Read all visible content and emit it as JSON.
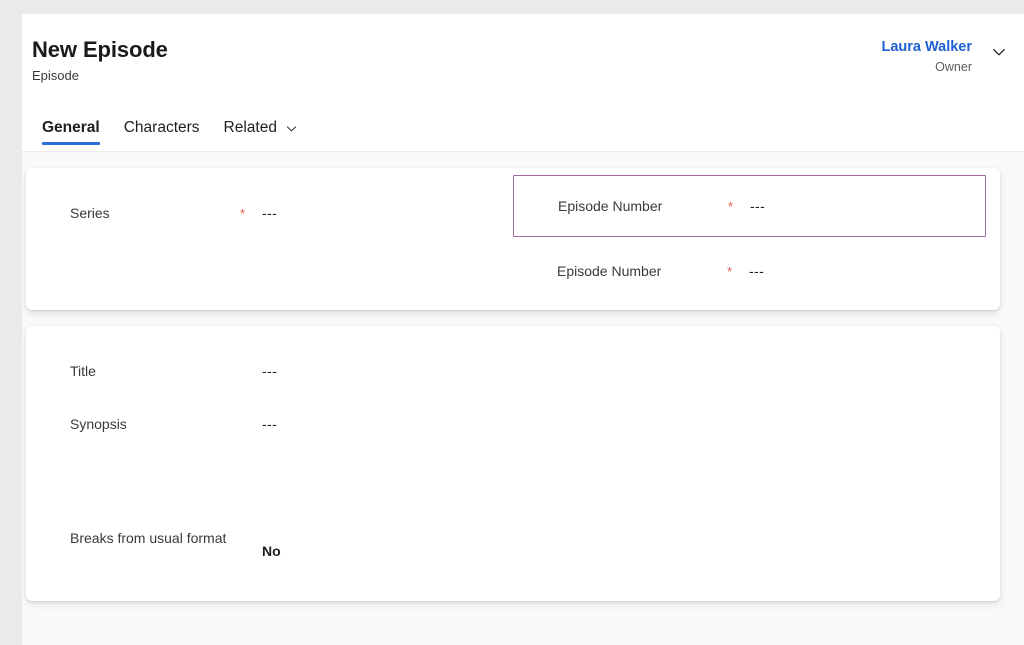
{
  "header": {
    "title": "New Episode",
    "subtitle": "Episode",
    "owner": {
      "name": "Laura Walker",
      "role": "Owner",
      "chevron_icon": "chevron-down-icon"
    }
  },
  "tabs": [
    {
      "label": "General",
      "active": true,
      "has_caret": false
    },
    {
      "label": "Characters",
      "active": false,
      "has_caret": false
    },
    {
      "label": "Related",
      "active": false,
      "has_caret": true,
      "caret_icon": "chevron-down-icon"
    }
  ],
  "colors": {
    "accent_blue": "#2b6bd8",
    "link_blue": "#1f60d1",
    "required_red": "#e8584d",
    "selection_purple": "#a1699c",
    "page_bg": "#faf9f8",
    "card_bg": "#ffffff",
    "frame_bg": "#ebeaea"
  },
  "required_marker": "*",
  "cards": [
    {
      "name": "summary-card",
      "left_fields": [
        {
          "label": "Series",
          "required": true,
          "value": "---"
        }
      ],
      "right_fields": [
        {
          "label": "Episode Number",
          "required": true,
          "value": "---",
          "selected": true
        },
        {
          "label": "Episode Number",
          "required": true,
          "value": "---",
          "selected": false
        }
      ]
    },
    {
      "name": "details-card",
      "left_fields": [
        {
          "label": "Title",
          "required": false,
          "value": "---"
        },
        {
          "label": "Synopsis",
          "required": false,
          "value": "---"
        },
        {
          "label": "Breaks from usual format",
          "required": false,
          "value": "No",
          "bold": true
        }
      ],
      "right_fields": []
    }
  ]
}
